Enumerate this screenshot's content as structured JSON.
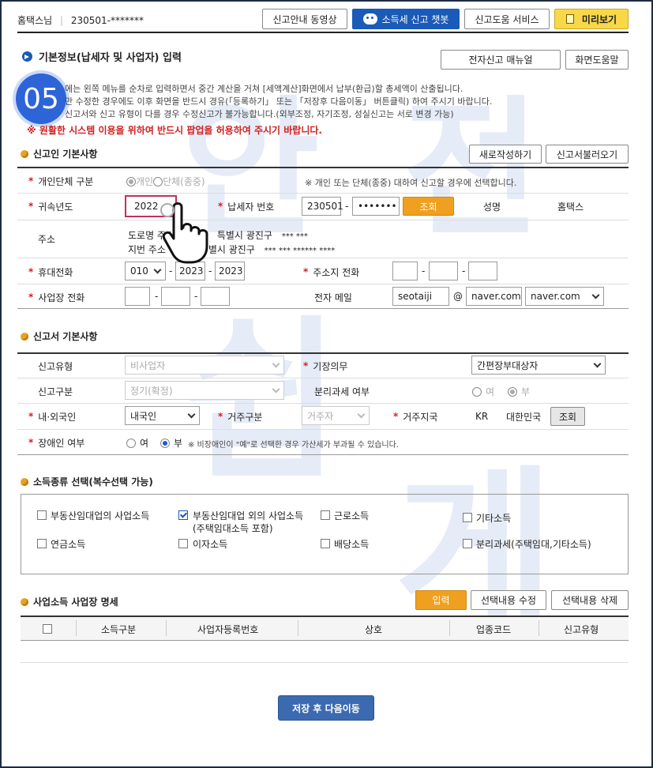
{
  "header": {
    "user": "홈택스님",
    "id": "230501-*******",
    "btn_video": "신고안내 동영상",
    "btn_chatbot": "소득세 신고 챗봇",
    "btn_help_service": "신고도움 서비스",
    "btn_preview": "미리보기"
  },
  "page": {
    "title": "기본정보(납세자 및 사업자) 입력",
    "btn_manual": "전자신고 매뉴얼",
    "btn_screen_help": "화면도움말",
    "step_badge": "05",
    "info_line1": "에는 왼쪽 메뉴를 순차로 입력하면서 중간 계산을 거쳐 [세액계산]화면에서 납부(환급)할 총세액이 산출됩니다.",
    "info_line2": "만 수정한 경우에도 이후 화면을 반드시 경유(「등록하기」 또는 「저장후 다음이동」 버튼클릭) 하여 주시기 바랍니다.",
    "info_line3": "신고서와 신고 유형이 다를 경우 수정신고가 불가능합니다.(외부조정, 자기조정, 성실신고는 서로 변경 가능)",
    "warning": "※ 원활한 시스템 이용을 위하여 반드시 팝업을 허용하여 주시기 바랍니다."
  },
  "reporter": {
    "section_title": "신고인 기본사항",
    "btn_new": "새로작성하기",
    "btn_load": "신고서불러오기",
    "type_label": "개인단체 구분",
    "type_opt1": "개인",
    "type_opt2": "단체(종중)",
    "type_note": "※ 개인 또는 단체(종중) 대하여 신고할 경우에 선택합니다.",
    "year_label": "귀속년도",
    "year_value": "2022",
    "taxpayer_no_label": "납세자 번호",
    "taxpayer_no_front": "230501",
    "taxpayer_no_back": "•••••••",
    "btn_lookup": "조회",
    "name_label": "성명",
    "name_value": "홈택스",
    "address_label": "주소",
    "road_address": "도로명 주소",
    "road_city": "특별시 광진구",
    "road_rest": "*** ***",
    "lot_address": "지번 주소",
    "lot_city": "별시 광진구",
    "lot_rest": "*** *** ****** ****",
    "mobile_label": "휴대전화",
    "mobile_1": "010",
    "mobile_2": "2023",
    "mobile_3": "2023",
    "home_phone_label": "주소지 전화",
    "biz_phone_label": "사업장 전화",
    "email_label": "전자 메일",
    "email_id": "seotaiji",
    "email_at": "@",
    "email_domain": "naver.com",
    "email_domain_select": "naver.com"
  },
  "report": {
    "section_title": "신고서 기본사항",
    "report_type_label": "신고유형",
    "report_type_value": "비사업자",
    "bookkeeping_label": "기장의무",
    "bookkeeping_value": "간편장부대상자",
    "report_class_label": "신고구분",
    "report_class_value": "정기(확정)",
    "separate_tax_label": "분리과세 여부",
    "separate_yes": "여",
    "separate_no": "부",
    "nationality_label": "내·외국인",
    "nationality_value": "내국인",
    "residence_label": "거주구분",
    "residence_value": "거주자",
    "residence_region_label": "거주지국",
    "country_code": "KR",
    "country_name": "대한민국",
    "btn_country_lookup": "조회",
    "disabled_label": "장애인 여부",
    "disabled_yes": "여",
    "disabled_no": "부",
    "disabled_note": "※ 비장애인이 \"예\"로 선택한 경우 가산세가 부과될 수 있습니다."
  },
  "income": {
    "section_title": "소득종류 선택(복수선택 가능)",
    "items": [
      "부동산임대업의 사업소득",
      "부동산임대업 외의 사업소득",
      "(주택임대소득 포함)",
      "근로소득",
      "기타소득",
      "연금소득",
      "이자소득",
      "배당소득",
      "분리과세(주택임대,기타소득)"
    ]
  },
  "workplace": {
    "section_title": "사업소득 사업장 명세",
    "btn_input": "입력",
    "btn_edit": "선택내용 수정",
    "btn_delete": "선택내용 삭제",
    "columns": [
      "소득구분",
      "사업자등록번호",
      "상호",
      "업종코드",
      "신고유형"
    ]
  },
  "footer": {
    "btn_save_next": "저장 후 다음이동"
  },
  "watermark": {
    "chars": [
      "안",
      "전",
      "쉽",
      "게"
    ]
  },
  "colors": {
    "accent_orange": "#f0a020",
    "chatbot_blue": "#1a5ab8",
    "preview_yellow": "#f8d848",
    "save_button": "#3c6ab0",
    "warning_red": "#d02020"
  }
}
